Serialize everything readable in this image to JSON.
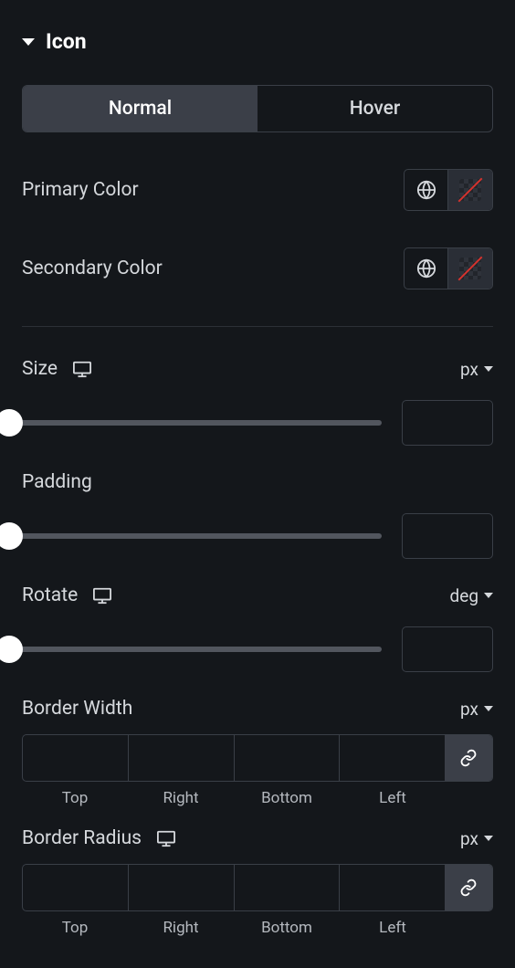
{
  "section": {
    "title": "Icon"
  },
  "tabs": {
    "normal": "Normal",
    "hover": "Hover"
  },
  "primaryColor": {
    "label": "Primary Color"
  },
  "secondaryColor": {
    "label": "Secondary Color"
  },
  "size": {
    "label": "Size",
    "unit": "px",
    "value": ""
  },
  "padding": {
    "label": "Padding",
    "value": ""
  },
  "rotate": {
    "label": "Rotate",
    "unit": "deg",
    "value": ""
  },
  "borderWidth": {
    "label": "Border Width",
    "unit": "px",
    "top": "",
    "right": "",
    "bottom": "",
    "left": "",
    "labels": {
      "top": "Top",
      "right": "Right",
      "bottom": "Bottom",
      "left": "Left"
    }
  },
  "borderRadius": {
    "label": "Border Radius",
    "unit": "px",
    "top": "",
    "right": "",
    "bottom": "",
    "left": "",
    "labels": {
      "top": "Top",
      "right": "Right",
      "bottom": "Bottom",
      "left": "Left"
    }
  }
}
